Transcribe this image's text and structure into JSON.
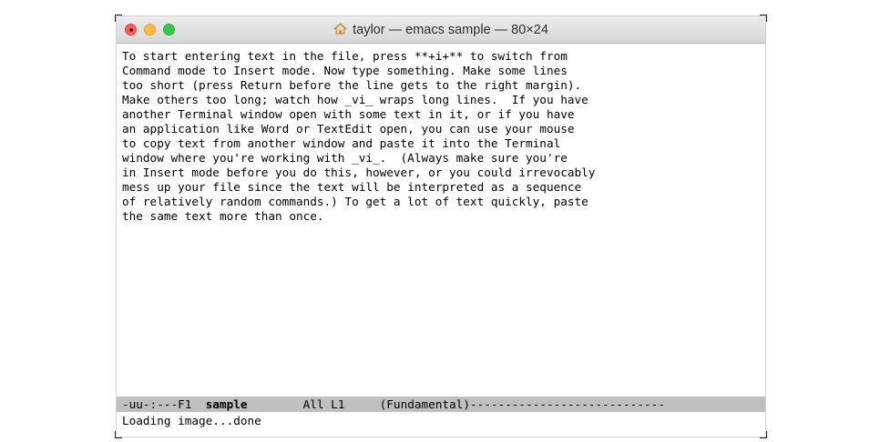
{
  "window": {
    "title": "taylor — emacs sample — 80×24",
    "title_icon": "house-icon"
  },
  "buffer": {
    "lines": [
      "To start entering text in the file, press **+i+** to switch from",
      "Command mode to Insert mode. Now type something. Make some lines",
      "too short (press Return before the line gets to the right margin).",
      "Make others too long; watch how _vi_ wraps long lines.  If you have",
      "another Terminal window open with some text in it, or if you have",
      "an application like Word or TextEdit open, you can use your mouse",
      "to copy text from another window and paste it into the Terminal",
      "window where you're working with _vi_.  (Always make sure you're",
      "in Insert mode before you do this, however, or you could irrevocably",
      "mess up your file since the text will be interpreted as a sequence",
      "of relatively random commands.) To get a lot of text quickly, paste",
      "the same text more than once."
    ]
  },
  "modeline": {
    "status": "-uu-:---F1  ",
    "buffer_name": "sample",
    "position": "        All L1     ",
    "mode": "(Fundamental)----------------------------"
  },
  "minibuffer": {
    "message": "Loading image...done"
  },
  "colors": {
    "close": "#fc605c",
    "minimize": "#fdbc40",
    "zoom": "#34c84a",
    "modeline_bg": "#bfbfbf"
  }
}
